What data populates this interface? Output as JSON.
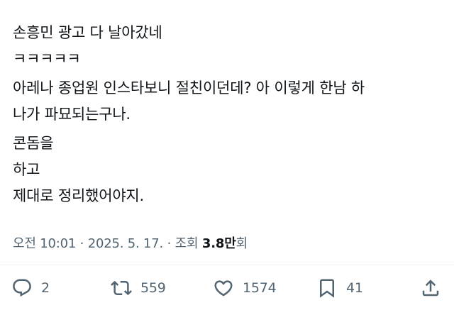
{
  "tweet": {
    "lines": [
      "손흥민 광고 다 날아갔네",
      "ㅋㅋㅋㅋㅋ",
      "아레나 종업원 인스타보니 절친이던데? 아 이렇게 한남 하",
      "나가 파묘되는구나.",
      "콘돔을",
      "하고",
      "제대로 정리했어야지."
    ]
  },
  "meta": {
    "time": "오전 10:01",
    "separator1": " · ",
    "date": "2025. 5. 17.",
    "separator2": " · ",
    "views_label": "조회",
    "views_count": "3.8만",
    "views_suffix": "회"
  },
  "actions": {
    "reply": {
      "icon": "reply-icon",
      "count": "2"
    },
    "retweet": {
      "icon": "retweet-icon",
      "count": "559"
    },
    "like": {
      "icon": "heart-icon",
      "count": "1574"
    },
    "bookmark": {
      "icon": "bookmark-icon",
      "count": "41"
    },
    "share": {
      "icon": "share-icon"
    }
  },
  "colors": {
    "text": "#0f1419",
    "secondary": "#536471",
    "divider": "#eff3f4",
    "background": "#ffffff"
  }
}
